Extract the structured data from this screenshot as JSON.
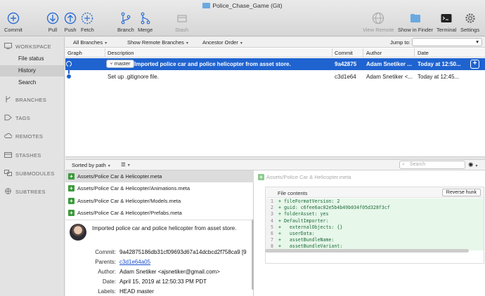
{
  "window": {
    "title": "Police_Chase_Game (Git)"
  },
  "toolbar": {
    "commit": "Commit",
    "pull": "Pull",
    "push": "Push",
    "fetch": "Fetch",
    "branch": "Branch",
    "merge": "Merge",
    "stash": "Stash",
    "view_remote": "View Remote",
    "show_in_finder": "Show in Finder",
    "terminal": "Terminal",
    "settings": "Settings"
  },
  "sidebar": {
    "workspace": "WORKSPACE",
    "items": [
      "File status",
      "History",
      "Search"
    ],
    "sections": [
      "BRANCHES",
      "TAGS",
      "REMOTES",
      "STASHES",
      "SUBMODULES",
      "SUBTREES"
    ]
  },
  "filters": {
    "branches": "All Branches",
    "remote": "Show Remote Branches",
    "order": "Ancestor Order",
    "jump_label": "Jump to:"
  },
  "columns": {
    "graph": "Graph",
    "description": "Description",
    "commit": "Commit",
    "author": "Author",
    "date": "Date"
  },
  "commits": [
    {
      "branch": "master",
      "description": "Imported police car and police helicopter from asset store.",
      "commit": "9a42875",
      "author": "Adam Snetiker ...",
      "date": "Today at 12:50..."
    },
    {
      "branch": "",
      "description": "Set up .gitignore file.",
      "commit": "c3d1e64",
      "author": "Adam Snetiker <...",
      "date": "Today at 12:45..."
    }
  ],
  "bottom": {
    "sort": "Sorted by path",
    "search_placeholder": "Search"
  },
  "files": [
    "Assets/Police Car & Helicopter.meta",
    "Assets/Police Car & Helicopter/Animations.meta",
    "Assets/Police Car & Helicopter/Models.meta",
    "Assets/Police Car & Helicopter/Prefabs.meta"
  ],
  "details": {
    "message": "Imported police car and police helicopter from asset store.",
    "commit_label": "Commit:",
    "commit": "9a42875186db31cf09693d67a14dcbcd2f758ca9 [9",
    "parents_label": "Parents:",
    "parents": "c3d1e64a05",
    "author_label": "Author:",
    "author": "Adam Snetiker <ajsnetiker@gmail.com>",
    "date_label": "Date:",
    "date": "April 15, 2019 at 12:50:33 PM PDT",
    "labels_label": "Labels:",
    "labels": "HEAD master"
  },
  "diff": {
    "file": "Assets/Police Car & Helicopter.meta",
    "header": "File contents",
    "reverse": "Reverse hunk",
    "lines": [
      {
        "n": "1",
        "t": "+ fileFormatVersion: 2"
      },
      {
        "n": "2",
        "t": "+ guid: c6fee6ac02e5b4b49b034f05d328f3cf"
      },
      {
        "n": "3",
        "t": "+ folderAsset: yes"
      },
      {
        "n": "4",
        "t": "+ DefaultImporter:"
      },
      {
        "n": "5",
        "t": "+   externalObjects: {}"
      },
      {
        "n": "6",
        "t": "+   userData:"
      },
      {
        "n": "7",
        "t": "+   assetBundleName:"
      },
      {
        "n": "8",
        "t": "+   assetBundleVariant:"
      }
    ]
  }
}
